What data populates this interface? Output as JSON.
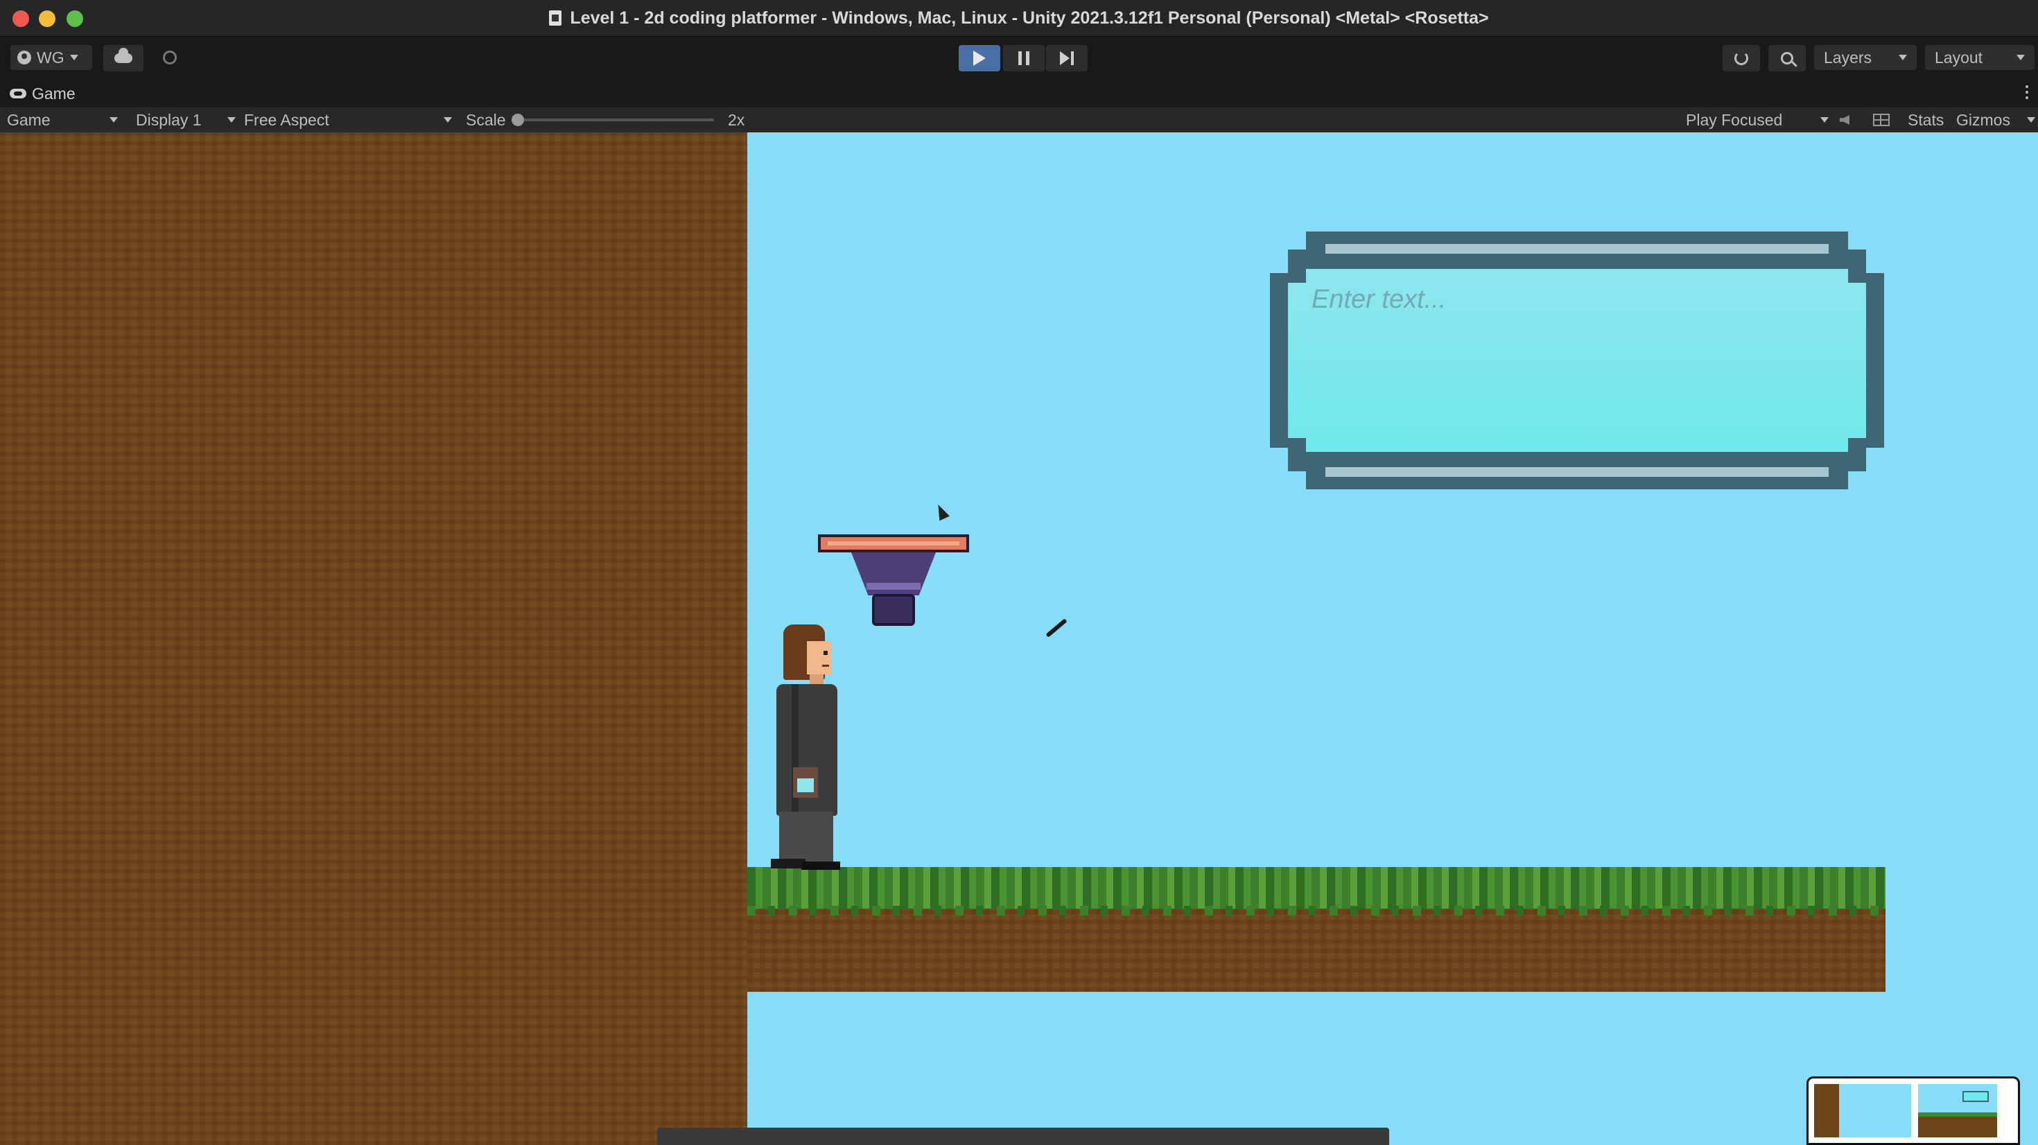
{
  "window": {
    "title": "Level 1 - 2d coding platformer - Windows, Mac, Linux - Unity 2021.3.12f1 Personal (Personal) <Metal> <Rosetta>"
  },
  "toolbar": {
    "account_label": "WG",
    "layers_label": "Layers",
    "layout_label": "Layout",
    "icons": [
      "user-icon",
      "cloud-icon",
      "collab-icon",
      "play-icon",
      "pause-icon",
      "step-icon",
      "history-icon",
      "search-icon"
    ]
  },
  "game_tab": {
    "label": "Game"
  },
  "view_bar": {
    "mode": "Game",
    "display": "Display 1",
    "aspect": "Free Aspect",
    "scale_label": "Scale",
    "scale_value": "2x",
    "play_mode": "Play Focused",
    "stats_label": "Stats",
    "gizmos_label": "Gizmos"
  },
  "game": {
    "text_input_placeholder": "Enter text..."
  },
  "colors": {
    "sky": "#87dcf8",
    "dirt": "#6d4318",
    "grass": "#3f8a2c",
    "panel_border": "#3f6675",
    "panel_fill": "#6fe9ec",
    "play_active": "#4a6fa5"
  }
}
